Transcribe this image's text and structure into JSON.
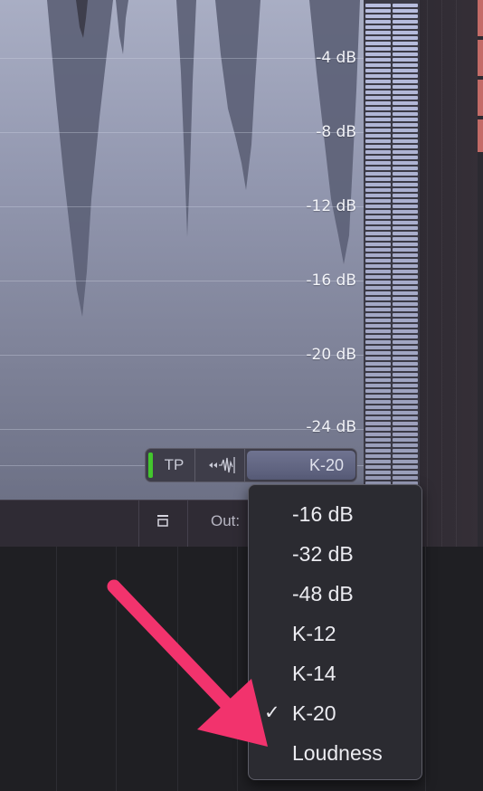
{
  "display": {
    "scale_labels": [
      "-4 dB",
      "-8 dB",
      "-12 dB",
      "-16 dB",
      "-20 dB",
      "-24 dB"
    ]
  },
  "modebar": {
    "tp_label": "TP",
    "waveform_icon": "waveform-icon",
    "mode_label": "K-20"
  },
  "bottom_strip": {
    "out_label": "Out:",
    "corner_icon": "panel-toggle-icon"
  },
  "menu": {
    "items": [
      {
        "label": "-16 dB",
        "checked": false
      },
      {
        "label": "-32 dB",
        "checked": false
      },
      {
        "label": "-48 dB",
        "checked": false
      },
      {
        "label": "K-12",
        "checked": false
      },
      {
        "label": "K-14",
        "checked": false
      },
      {
        "label": "K-20",
        "checked": true
      },
      {
        "label": "Loudness",
        "checked": false
      }
    ],
    "check_glyph": "✓"
  },
  "colors": {
    "accent_arrow": "#f2336d",
    "led_green": "#43c62d",
    "meter_segment": "#b8bedf",
    "display_bg": "#9398b0"
  }
}
